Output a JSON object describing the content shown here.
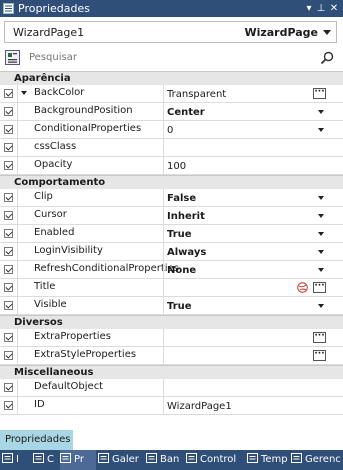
{
  "window": {
    "title": "Propriedades"
  },
  "object_selector": {
    "name": "WizardPage1",
    "type": "WizardPage"
  },
  "search": {
    "placeholder": "Pesquisar"
  },
  "categories": [
    {
      "label": "Aparência",
      "rows": [
        {
          "name": "BackColor",
          "value": "Transparent",
          "bold": false,
          "editor": "ellipsis",
          "expander": true
        },
        {
          "name": "BackgroundPosition",
          "value": "Center",
          "bold": true,
          "editor": "dropdown"
        },
        {
          "name": "ConditionalProperties",
          "value": "0",
          "bold": false,
          "editor": "dropdown"
        },
        {
          "name": "cssClass",
          "value": "",
          "bold": false,
          "editor": "none"
        },
        {
          "name": "Opacity",
          "value": "100",
          "bold": false,
          "editor": "none"
        }
      ]
    },
    {
      "label": "Comportamento",
      "rows": [
        {
          "name": "Clip",
          "value": "False",
          "bold": true,
          "editor": "dropdown"
        },
        {
          "name": "Cursor",
          "value": "Inherit",
          "bold": true,
          "editor": "dropdown"
        },
        {
          "name": "Enabled",
          "value": "True",
          "bold": true,
          "editor": "dropdown"
        },
        {
          "name": "LoginVisibility",
          "value": "Always",
          "bold": true,
          "editor": "dropdown"
        },
        {
          "name": "RefreshConditionalProperties",
          "value": "None",
          "bold": true,
          "editor": "dropdown"
        },
        {
          "name": "Title",
          "value": "",
          "bold": false,
          "editor": "globe-ellipsis"
        },
        {
          "name": "Visible",
          "value": "True",
          "bold": true,
          "editor": "dropdown"
        }
      ]
    },
    {
      "label": "Diversos",
      "rows": [
        {
          "name": "ExtraProperties",
          "value": "",
          "bold": false,
          "editor": "ellipsis"
        },
        {
          "name": "ExtraStyleProperties",
          "value": "",
          "bold": false,
          "editor": "ellipsis"
        }
      ]
    },
    {
      "label": "Miscellaneous",
      "rows": [
        {
          "name": "DefaultObject",
          "value": "",
          "bold": false,
          "editor": "none"
        },
        {
          "name": "ID",
          "value": "WizardPage1",
          "bold": false,
          "editor": "none"
        }
      ]
    }
  ],
  "panel_tab": {
    "label": "Propriedades"
  },
  "bottom_tabs": [
    {
      "label": "I",
      "icon": "toolbox-icon"
    },
    {
      "label": "C",
      "icon": "gear-icon"
    },
    {
      "label": "Pr",
      "icon": "document-icon",
      "active": true
    },
    {
      "label": "Galer",
      "icon": "gallery-icon"
    },
    {
      "label": "Ban",
      "icon": "database-icon"
    },
    {
      "label": "Control",
      "icon": "control-icon"
    },
    {
      "label": "Temp",
      "icon": "template-icon"
    },
    {
      "label": "Gerenc",
      "icon": "manager-icon"
    }
  ],
  "colors": {
    "titlebar": "#2f4e78",
    "category_bg": "#e6e6e6",
    "panel_tab": "#a9d6e5"
  }
}
